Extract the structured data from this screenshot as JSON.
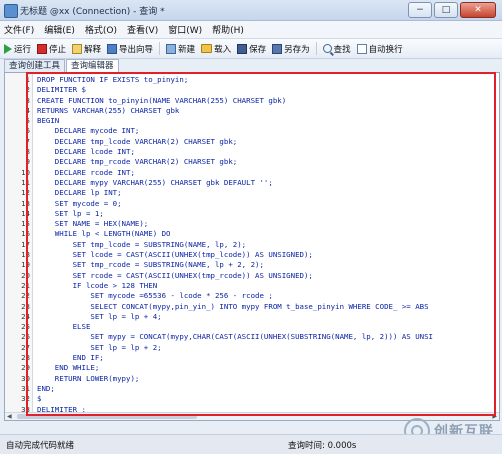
{
  "window": {
    "title": "无标题 @xx (Connection) - 查询 *",
    "btn_min": "−",
    "btn_max": "□",
    "btn_close": "✕"
  },
  "menu": [
    "文件(F)",
    "编辑(E)",
    "格式(O)",
    "查看(V)",
    "窗口(W)",
    "帮助(H)"
  ],
  "toolbar": {
    "run": "运行",
    "stop": "停止",
    "explain": "解释",
    "export": "导出向导",
    "new": "新建",
    "load": "载入",
    "save": "保存",
    "save_as": "另存为",
    "find": "查找",
    "wrap": "自动换行"
  },
  "tabs": [
    "查询创建工具",
    "查询编辑器"
  ],
  "code_lines": [
    "DROP FUNCTION IF EXISTS to_pinyin;",
    "DELIMITER $",
    "CREATE FUNCTION to_pinyin(NAME VARCHAR(255) CHARSET gbk)",
    "RETURNS VARCHAR(255) CHARSET gbk",
    "BEGIN",
    "    DECLARE mycode INT;",
    "    DECLARE tmp_lcode VARCHAR(2) CHARSET gbk;",
    "    DECLARE lcode INT;",
    "    DECLARE tmp_rcode VARCHAR(2) CHARSET gbk;",
    "    DECLARE rcode INT;",
    "    DECLARE mypy VARCHAR(255) CHARSET gbk DEFAULT '';",
    "    DECLARE lp INT;",
    "    SET mycode = 0;",
    "    SET lp = 1;",
    "    SET NAME = HEX(NAME);",
    "    WHILE lp < LENGTH(NAME) DO",
    "        SET tmp_lcode = SUBSTRING(NAME, lp, 2);",
    "        SET lcode = CAST(ASCII(UNHEX(tmp_lcode)) AS UNSIGNED);",
    "        SET tmp_rcode = SUBSTRING(NAME, lp + 2, 2);",
    "        SET rcode = CAST(ASCII(UNHEX(tmp_rcode)) AS UNSIGNED);",
    "        IF lcode > 128 THEN",
    "            SET mycode =65536 - lcode * 256 - rcode ;",
    "            SELECT CONCAT(mypy,pin_yin_) INTO mypy FROM t_base_pinyin WHERE CODE_ >= ABS",
    "            SET lp = lp + 4;",
    "        ELSE",
    "            SET mypy = CONCAT(mypy,CHAR(CAST(ASCII(UNHEX(SUBSTRING(NAME, lp, 2))) AS UNSI",
    "            SET lp = lp + 2;",
    "        END IF;",
    "    END WHILE;",
    "    RETURN LOWER(mypy);",
    "END;",
    "$",
    "DELIMITER ;"
  ],
  "status": {
    "left": "自动完成代码就绪",
    "query_time": "查询时间: 0.000s"
  },
  "watermark": "创新互联",
  "colors": {
    "highlight_box": "#e0202a",
    "code_keyword": "#0b24a6"
  }
}
